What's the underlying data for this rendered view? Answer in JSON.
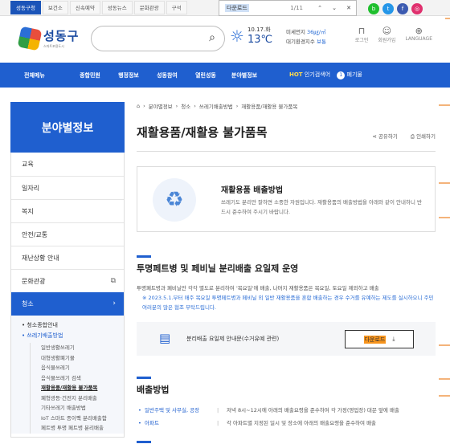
{
  "topbar": {
    "tabs": [
      "성동구청",
      "보건소",
      "신속예약",
      "성동뉴스",
      "문화관광",
      "구석"
    ],
    "find": {
      "query": "다운로드",
      "count": "1/11"
    },
    "social": [
      {
        "label": "b",
        "color": "#1fbf2e"
      },
      {
        "label": "t",
        "color": "#2596e8"
      },
      {
        "label": "f",
        "color": "#3b5ab0"
      },
      {
        "label": "◎",
        "color": "#e0306e"
      }
    ]
  },
  "header": {
    "logo_name": "성동구",
    "logo_sub": "스마트포용도시",
    "search_placeholder": "",
    "weather": {
      "date": "10.17.화",
      "temp": "13℃"
    },
    "dust": {
      "fine_label": "미세먼지",
      "fine_value": "36㎍/㎥",
      "air_label": "대기환경지수",
      "air_value": "보통"
    },
    "utils": [
      "로그인",
      "회원가입",
      "LANGUAGE"
    ]
  },
  "gnb": {
    "all": "전체메뉴",
    "items": [
      "종합민원",
      "행정정보",
      "성동참여",
      "열린성동",
      "분야별정보"
    ],
    "hot_label": "HOT",
    "hot_text": "인기검색어",
    "hot_num": "1",
    "hot_keyword": "폐기물"
  },
  "lnb": {
    "title": "분야별정보",
    "items": [
      "교육",
      "일자리",
      "복지",
      "안전/교통",
      "재난상황 안내",
      "문화관광",
      "청소"
    ],
    "sub1": [
      "청소종합안내",
      "쓰레기배출방법"
    ],
    "sub2": [
      "일반생활쓰레기",
      "대형생활폐기물",
      "음식물쓰레기",
      "음식물쓰레기 검색",
      "재활용품/재활용 불가품목",
      "폐형광등·건전지 분리배출",
      "기타쓰레기 배출방법",
      "IoT 스마트 종이팩 분리배출함",
      "페트병 투명 페트병 분리배출"
    ]
  },
  "content": {
    "breadcrumb": [
      "분야별정보",
      "청소",
      "쓰레기배출방법",
      "재활용품/재활용 불가품목"
    ],
    "title": "재활용품/재활용 불가품목",
    "share": "공유하기",
    "print": "인쇄하기",
    "info_title": "재활용품 배출방법",
    "info_desc": "쓰레기도 분리만 잘하면 소중한 자원입니다. 재활용품의 배출방법을 아래와 같이 안내하니 반드시 준수하여 주시기 바랍니다.",
    "section1": "투명페트병 및 페비닐 분리배출 요일제 운영",
    "section1_p1": "투명페트병과 페비닐만 각각 별도로 분리하여 '목요일'에 배출, 나머지 재활용품은 목요일, 토요일 제외하고 배출",
    "section1_p2": "※ 2023.5.1.부터 매주 목요일 투명페트병과 페비닐 외 일반 재활용품을 혼합 배출하는 경우 수거를 유예하는 제도를 실시하오니 주민 여러분의 많은 협조 부탁드립니다.",
    "download_text": "분리배출 요일제 안내문(수거유예 관련)",
    "download_btn": "다운로드",
    "section2": "배출방법",
    "rows": [
      {
        "k": "일반주택 및 사무실, 공장",
        "v": "저녁 8시~12시에 아래의 배출요령을 준수하여 각 가정(영업장) 대문 앞에 배출"
      },
      {
        "k": "아파트",
        "v": "각 아파트별 지정된 일시 및 장소에 아래의 배출요령을 준수하여 배출"
      }
    ]
  }
}
